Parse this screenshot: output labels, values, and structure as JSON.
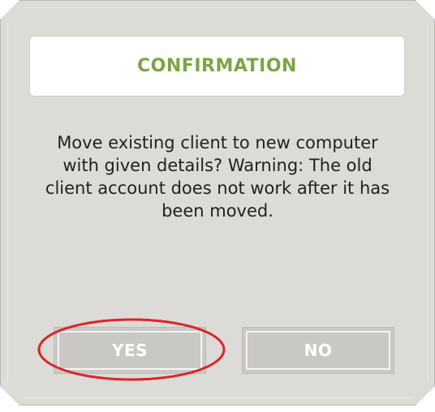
{
  "dialog": {
    "title": "CONFIRMATION",
    "message": "Move existing client to new computer with given details? Warning: The old client account does not work after it has been moved.",
    "buttons": {
      "yes_label": "YES",
      "no_label": "NO"
    }
  },
  "colors": {
    "title_color": "#7aa541",
    "panel_background": "#dcdbd7",
    "button_background": "#c9c8c5",
    "highlight_color": "#d6282c"
  }
}
